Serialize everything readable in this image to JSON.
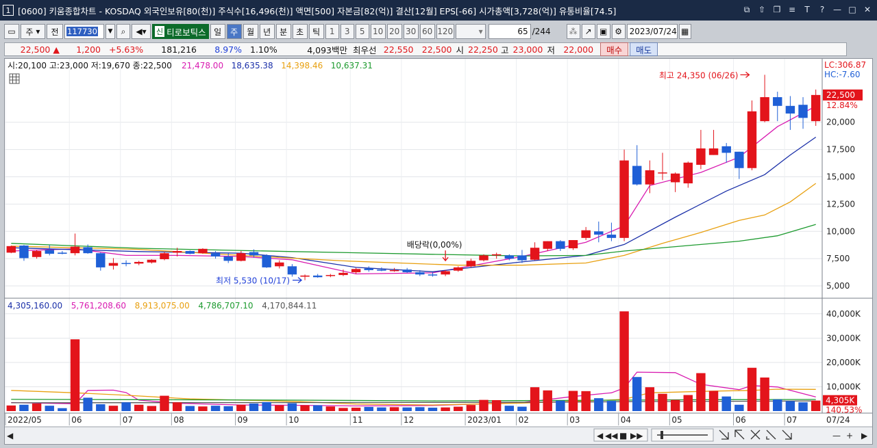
{
  "window": {
    "num": "1",
    "title": "[0600] 키움종합차트 - KOSDAQ 외국인보유[80(천)] 주식수[16,496(천)] 액면[500] 자본금[82(억)] 결산[12월] EPS[-66] 시가총액[3,728(억)] 유통비율[74.5]",
    "controls": [
      "⧉",
      "⇧",
      "❐",
      "≡",
      "T",
      "?",
      "—",
      "□",
      "✕"
    ]
  },
  "toolbar": {
    "period_sel": "주",
    "prev": "전",
    "code": "117730",
    "badge": "신",
    "stock_name": "티로보틱스",
    "periods": [
      "일",
      "주",
      "월",
      "년",
      "분",
      "초",
      "틱"
    ],
    "active_period": "주",
    "intervals": [
      "1",
      "3",
      "5",
      "10",
      "20",
      "30",
      "60",
      "120"
    ],
    "count": "65",
    "total": "/244",
    "date": "2023/07/24"
  },
  "quote": {
    "price": "22,500",
    "arrow": "▲",
    "change": "1,200",
    "rate": "+5.63%",
    "volume": "181,216",
    "turnover": "8.97%",
    "vol_ratio": "1.10%",
    "amount": "4,093백만",
    "best_label": "최우선",
    "ask": "22,550",
    "bid": "22,500",
    "open_label": "시",
    "open": "22,250",
    "high_label": "고",
    "high": "23,000",
    "low_label": "저",
    "low": "22,000",
    "buy": "매수",
    "sell": "매도"
  },
  "chart_data": {
    "type": "candlestick",
    "price_header": {
      "ohlc": "시:20,100 고:23,000 저:19,670 종:22,500",
      "ma": [
        {
          "value": "21,478.00",
          "color": "#d81ab0"
        },
        {
          "value": "18,635.38",
          "color": "#1a2fa8"
        },
        {
          "value": "14,398.46",
          "color": "#e8a010"
        },
        {
          "value": "10,637.31",
          "color": "#1c9a2e"
        }
      ]
    },
    "volume_header": [
      {
        "value": "4,305,160.00",
        "color": "#1a2fa8"
      },
      {
        "value": "5,761,208.60",
        "color": "#d81ab0"
      },
      {
        "value": "8,913,075.00",
        "color": "#e8a010"
      },
      {
        "value": "4,786,707.10",
        "color": "#1c9a2e"
      },
      {
        "value": "4,170,844.11",
        "color": "#555555"
      }
    ],
    "price_ticks": [
      "22,500",
      "20,000",
      "17,500",
      "15,000",
      "12,500",
      "10,000",
      "7,500",
      "5,000"
    ],
    "volume_ticks": [
      "40,000K",
      "30,000K",
      "20,000K",
      "10,000K"
    ],
    "price_ylim": [
      4000,
      25500
    ],
    "volume_ylim": [
      0,
      45000
    ],
    "lc": "LC:306.87",
    "hc": "HC:-7.60",
    "last_price_tag": "22,500",
    "last_pct_tag": "12.84%",
    "last_vol_tag": "4,305K",
    "last_vol_pct": "140.53%",
    "x_labels": [
      {
        "i": 0,
        "label": "2022/05"
      },
      {
        "i": 5,
        "label": "06"
      },
      {
        "i": 9,
        "label": "07"
      },
      {
        "i": 13,
        "label": "08"
      },
      {
        "i": 18,
        "label": "09"
      },
      {
        "i": 22,
        "label": "10"
      },
      {
        "i": 27,
        "label": "11"
      },
      {
        "i": 31,
        "label": "12"
      },
      {
        "i": 36,
        "label": "2023/01"
      },
      {
        "i": 40,
        "label": "02"
      },
      {
        "i": 44,
        "label": "03"
      },
      {
        "i": 48,
        "label": "04"
      },
      {
        "i": 52,
        "label": "05"
      },
      {
        "i": 57,
        "label": "06"
      },
      {
        "i": 61,
        "label": "07"
      }
    ],
    "end_label": "07/24",
    "annotations": {
      "high": "최고 24,350 (06/26)",
      "low": "최저 5,530 (10/17)",
      "dividend": "배당락(0,00%)"
    },
    "candles": [
      {
        "o": 8050,
        "h": 8700,
        "l": 8000,
        "c": 8650
      },
      {
        "o": 8700,
        "h": 8750,
        "l": 7300,
        "c": 7550
      },
      {
        "o": 7650,
        "h": 8300,
        "l": 7500,
        "c": 8200
      },
      {
        "o": 8300,
        "h": 8750,
        "l": 7800,
        "c": 7950
      },
      {
        "o": 8050,
        "h": 8200,
        "l": 7900,
        "c": 7950
      },
      {
        "o": 8000,
        "h": 9800,
        "l": 7800,
        "c": 8600
      },
      {
        "o": 8550,
        "h": 8800,
        "l": 7950,
        "c": 8000
      },
      {
        "o": 8000,
        "h": 8050,
        "l": 6400,
        "c": 6700
      },
      {
        "o": 6850,
        "h": 7550,
        "l": 6500,
        "c": 7100
      },
      {
        "o": 7100,
        "h": 7350,
        "l": 6800,
        "c": 7050
      },
      {
        "o": 7050,
        "h": 7300,
        "l": 6900,
        "c": 7200
      },
      {
        "o": 7150,
        "h": 7450,
        "l": 7050,
        "c": 7400
      },
      {
        "o": 7450,
        "h": 8100,
        "l": 7350,
        "c": 8000
      },
      {
        "o": 8050,
        "h": 8500,
        "l": 7700,
        "c": 8200
      },
      {
        "o": 8200,
        "h": 8250,
        "l": 7900,
        "c": 7950
      },
      {
        "o": 8000,
        "h": 8450,
        "l": 7950,
        "c": 8400
      },
      {
        "o": 8000,
        "h": 8200,
        "l": 7500,
        "c": 7700
      },
      {
        "o": 7700,
        "h": 8000,
        "l": 7100,
        "c": 7300
      },
      {
        "o": 7300,
        "h": 8200,
        "l": 7250,
        "c": 8000
      },
      {
        "o": 8100,
        "h": 8350,
        "l": 7600,
        "c": 7800
      },
      {
        "o": 7800,
        "h": 7900,
        "l": 6650,
        "c": 6700
      },
      {
        "o": 6800,
        "h": 7350,
        "l": 6600,
        "c": 7150
      },
      {
        "o": 6800,
        "h": 7000,
        "l": 5850,
        "c": 6050
      },
      {
        "o": 5850,
        "h": 6050,
        "l": 5530,
        "c": 5950
      },
      {
        "o": 5950,
        "h": 6100,
        "l": 5750,
        "c": 5800
      },
      {
        "o": 5950,
        "h": 6100,
        "l": 5800,
        "c": 6000
      },
      {
        "o": 6000,
        "h": 6500,
        "l": 5900,
        "c": 6200
      },
      {
        "o": 6250,
        "h": 6650,
        "l": 6100,
        "c": 6550
      },
      {
        "o": 6600,
        "h": 6800,
        "l": 6300,
        "c": 6450
      },
      {
        "o": 6500,
        "h": 6700,
        "l": 6350,
        "c": 6400
      },
      {
        "o": 6400,
        "h": 6650,
        "l": 6300,
        "c": 6450
      },
      {
        "o": 6500,
        "h": 6650,
        "l": 6200,
        "c": 6250
      },
      {
        "o": 6250,
        "h": 6450,
        "l": 5900,
        "c": 6050
      },
      {
        "o": 6050,
        "h": 6250,
        "l": 5850,
        "c": 6000
      },
      {
        "o": 6050,
        "h": 6450,
        "l": 5900,
        "c": 6350
      },
      {
        "o": 6400,
        "h": 6800,
        "l": 6300,
        "c": 6700
      },
      {
        "o": 6800,
        "h": 7500,
        "l": 6700,
        "c": 7300
      },
      {
        "o": 7350,
        "h": 7900,
        "l": 7250,
        "c": 7800
      },
      {
        "o": 7800,
        "h": 8050,
        "l": 7500,
        "c": 7900
      },
      {
        "o": 7800,
        "h": 7900,
        "l": 7350,
        "c": 7500
      },
      {
        "o": 7800,
        "h": 8300,
        "l": 7100,
        "c": 7350
      },
      {
        "o": 7400,
        "h": 9000,
        "l": 7350,
        "c": 8500
      },
      {
        "o": 8400,
        "h": 9100,
        "l": 8200,
        "c": 9100
      },
      {
        "o": 9100,
        "h": 9200,
        "l": 8200,
        "c": 8400
      },
      {
        "o": 8450,
        "h": 9200,
        "l": 8300,
        "c": 9200
      },
      {
        "o": 9400,
        "h": 10400,
        "l": 9200,
        "c": 10100
      },
      {
        "o": 10000,
        "h": 10900,
        "l": 9000,
        "c": 9700
      },
      {
        "o": 9700,
        "h": 10800,
        "l": 9100,
        "c": 9400
      },
      {
        "o": 9400,
        "h": 17500,
        "l": 9100,
        "c": 16500
      },
      {
        "o": 16000,
        "h": 17900,
        "l": 14200,
        "c": 14300
      },
      {
        "o": 14300,
        "h": 16500,
        "l": 13500,
        "c": 15600
      },
      {
        "o": 15400,
        "h": 17200,
        "l": 14700,
        "c": 15400
      },
      {
        "o": 14500,
        "h": 15400,
        "l": 13600,
        "c": 15300
      },
      {
        "o": 14400,
        "h": 16400,
        "l": 14000,
        "c": 16300
      },
      {
        "o": 16100,
        "h": 19300,
        "l": 15700,
        "c": 17600
      },
      {
        "o": 17000,
        "h": 19300,
        "l": 17000,
        "c": 17600
      },
      {
        "o": 17800,
        "h": 18100,
        "l": 16300,
        "c": 17200
      },
      {
        "o": 17300,
        "h": 17300,
        "l": 14800,
        "c": 15800
      },
      {
        "o": 15800,
        "h": 22000,
        "l": 15600,
        "c": 21000
      },
      {
        "o": 20100,
        "h": 24350,
        "l": 20000,
        "c": 22300
      },
      {
        "o": 22300,
        "h": 22800,
        "l": 20100,
        "c": 21500
      },
      {
        "o": 21500,
        "h": 22400,
        "l": 19300,
        "c": 20800
      },
      {
        "o": 21600,
        "h": 22300,
        "l": 19400,
        "c": 20400
      },
      {
        "o": 20100,
        "h": 23000,
        "l": 19670,
        "c": 22500
      }
    ],
    "volumes": [
      2300,
      2600,
      3100,
      2200,
      1200,
      29500,
      5500,
      2800,
      2200,
      3600,
      2600,
      2100,
      6300,
      3600,
      2100,
      1900,
      2200,
      2000,
      2600,
      3100,
      3700,
      2400,
      3200,
      2400,
      2400,
      1900,
      1300,
      1400,
      1700,
      1500,
      1600,
      1500,
      1600,
      1400,
      1500,
      1800,
      2500,
      4600,
      4500,
      2200,
      1800,
      9800,
      8500,
      4300,
      8300,
      8200,
      5300,
      4200,
      41000,
      14000,
      9800,
      7100,
      4600,
      6600,
      15600,
      8300,
      6000,
      2600,
      17800,
      13800,
      4800,
      4100,
      3600,
      4305
    ],
    "ma_lines": [
      {
        "name": "ma1",
        "color": "#d81ab0",
        "pts": [
          [
            0,
            8200
          ],
          [
            5,
            8400
          ],
          [
            9,
            7800
          ],
          [
            13,
            7800
          ],
          [
            18,
            7700
          ],
          [
            22,
            7400
          ],
          [
            27,
            6100
          ],
          [
            33,
            6200
          ],
          [
            40,
            7700
          ],
          [
            45,
            9000
          ],
          [
            48,
            10500
          ],
          [
            50,
            14200
          ],
          [
            54,
            15400
          ],
          [
            57,
            16800
          ],
          [
            60,
            19600
          ],
          [
            63,
            21478
          ]
        ]
      },
      {
        "name": "ma2",
        "color": "#1a2fa8",
        "pts": [
          [
            0,
            8500
          ],
          [
            10,
            8150
          ],
          [
            18,
            8000
          ],
          [
            22,
            7600
          ],
          [
            27,
            6700
          ],
          [
            33,
            6300
          ],
          [
            40,
            7200
          ],
          [
            45,
            7800
          ],
          [
            48,
            8800
          ],
          [
            52,
            11300
          ],
          [
            56,
            13700
          ],
          [
            59,
            15200
          ],
          [
            61,
            17000
          ],
          [
            63,
            18635
          ]
        ]
      },
      {
        "name": "ma3",
        "color": "#e8a010",
        "pts": [
          [
            0,
            8650
          ],
          [
            10,
            8350
          ],
          [
            18,
            7800
          ],
          [
            26,
            7300
          ],
          [
            35,
            6900
          ],
          [
            40,
            6900
          ],
          [
            45,
            7100
          ],
          [
            48,
            7800
          ],
          [
            51,
            8900
          ],
          [
            54,
            9900
          ],
          [
            57,
            11000
          ],
          [
            59,
            11500
          ],
          [
            61,
            12700
          ],
          [
            63,
            14398
          ]
        ]
      },
      {
        "name": "ma4",
        "color": "#1c9a2e",
        "pts": [
          [
            0,
            8900
          ],
          [
            10,
            8450
          ],
          [
            22,
            8150
          ],
          [
            33,
            7900
          ],
          [
            40,
            7750
          ],
          [
            45,
            7800
          ],
          [
            48,
            8200
          ],
          [
            52,
            8600
          ],
          [
            57,
            9100
          ],
          [
            60,
            9600
          ],
          [
            63,
            10637
          ]
        ]
      }
    ],
    "vol_ma_lines": [
      {
        "name": "vma1",
        "color": "#d81ab0",
        "pts": [
          [
            0,
            3500
          ],
          [
            5,
            3000
          ],
          [
            6,
            8500
          ],
          [
            8,
            8600
          ],
          [
            9,
            7600
          ],
          [
            10,
            4500
          ],
          [
            13,
            3200
          ],
          [
            18,
            2500
          ],
          [
            22,
            2400
          ],
          [
            27,
            2100
          ],
          [
            33,
            2300
          ],
          [
            40,
            3500
          ],
          [
            44,
            6000
          ],
          [
            47,
            7500
          ],
          [
            48,
            9500
          ],
          [
            49,
            16000
          ],
          [
            52,
            15800
          ],
          [
            54,
            11000
          ],
          [
            57,
            8800
          ],
          [
            58,
            10500
          ],
          [
            60,
            9900
          ],
          [
            63,
            5800
          ]
        ]
      },
      {
        "name": "vma2",
        "color": "#e8a010",
        "pts": [
          [
            0,
            8500
          ],
          [
            5,
            7500
          ],
          [
            9,
            6500
          ],
          [
            14,
            5000
          ],
          [
            22,
            4000
          ],
          [
            27,
            2900
          ],
          [
            33,
            2500
          ],
          [
            40,
            3300
          ],
          [
            45,
            4200
          ],
          [
            48,
            4800
          ],
          [
            50,
            7500
          ],
          [
            55,
            8200
          ],
          [
            58,
            8500
          ],
          [
            60,
            9000
          ],
          [
            63,
            8913
          ]
        ]
      },
      {
        "name": "vma3",
        "color": "#1c9a2e",
        "pts": [
          [
            0,
            4800
          ],
          [
            10,
            4700
          ],
          [
            22,
            4500
          ],
          [
            33,
            4200
          ],
          [
            40,
            4300
          ],
          [
            48,
            4500
          ],
          [
            55,
            4700
          ],
          [
            63,
            4787
          ]
        ]
      },
      {
        "name": "vma4",
        "color": "#555555",
        "pts": [
          [
            0,
            3400
          ],
          [
            20,
            3500
          ],
          [
            40,
            3600
          ],
          [
            50,
            3900
          ],
          [
            63,
            4170
          ]
        ]
      }
    ]
  },
  "scrollbar": {
    "buttons": [
      "◀",
      "◀◀",
      "■",
      "▶▶",
      "▶"
    ],
    "zoom": [
      "—",
      "+"
    ],
    "right_arrow": "▶"
  }
}
